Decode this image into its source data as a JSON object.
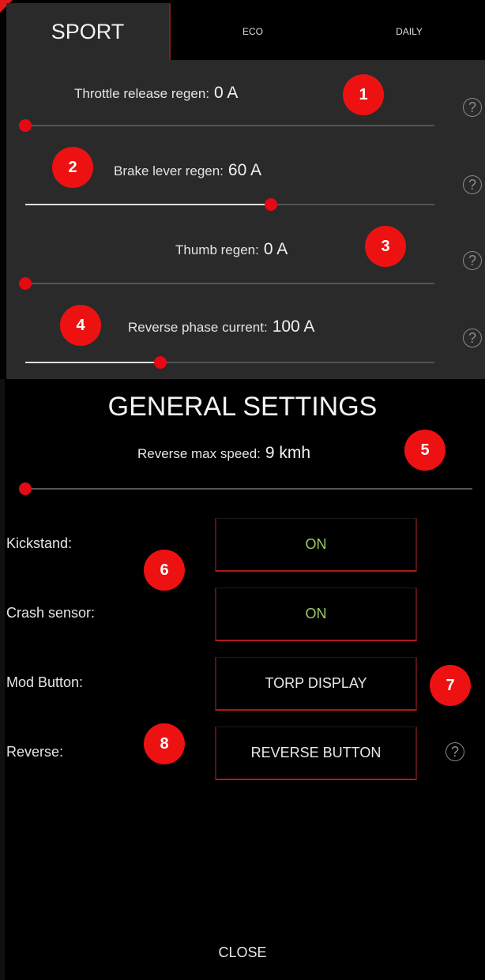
{
  "tabs": {
    "sport": "SPORT",
    "eco": "ECO",
    "daily": "DAILY"
  },
  "mode_settings": [
    {
      "label": "Throttle release regen:",
      "value": "0 A",
      "level": 0.0
    },
    {
      "label": "Brake lever regen:",
      "value": "60 A",
      "level": 0.6
    },
    {
      "label": "Thumb regen:",
      "value": "0 A",
      "level": 0.0
    },
    {
      "label": "Reverse phase current:",
      "value": "100 A",
      "level": 0.33
    }
  ],
  "help_glyph": "?",
  "general": {
    "title": "GENERAL SETTINGS",
    "reverse_speed_label": "Reverse max speed:",
    "reverse_speed_value": "9 kmh",
    "reverse_speed_level": 0.0,
    "rows": [
      {
        "label": "Kickstand:",
        "value": "ON"
      },
      {
        "label": "Crash sensor:",
        "value": "ON"
      },
      {
        "label": "Mod Button:",
        "value": "TORP DISPLAY"
      },
      {
        "label": "Reverse:",
        "value": "REVERSE BUTTON"
      }
    ]
  },
  "badges": [
    "1",
    "2",
    "3",
    "4",
    "5",
    "6",
    "7",
    "8"
  ],
  "close_label": "CLOSE",
  "colors": {
    "accent": "#e50914",
    "on": "#9ccc65",
    "panel": "#2a2a2a",
    "badge": "#ee1111"
  },
  "icons": {
    "help": "help-circle-icon"
  }
}
